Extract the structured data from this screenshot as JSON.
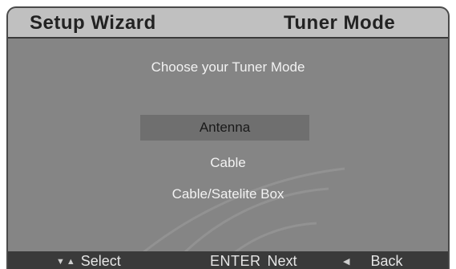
{
  "header": {
    "title": "Setup Wizard",
    "mode": "Tuner Mode"
  },
  "main": {
    "prompt": "Choose your Tuner Mode",
    "options": [
      {
        "label": "Antenna",
        "selected": true
      },
      {
        "label": "Cable",
        "selected": false
      },
      {
        "label": "Cable/Satelite Box",
        "selected": false
      }
    ]
  },
  "footer": {
    "select_label": "Select",
    "enter_key": "ENTER",
    "next_label": "Next",
    "back_label": "Back",
    "icons": [
      "arrow-down-icon",
      "arrow-up-icon",
      "arrow-left-icon"
    ]
  },
  "colors": {
    "panel": "#858585",
    "header": "#c0c0c0",
    "selected_row": "#6f6f6f",
    "footer": "#3a3a3a"
  }
}
